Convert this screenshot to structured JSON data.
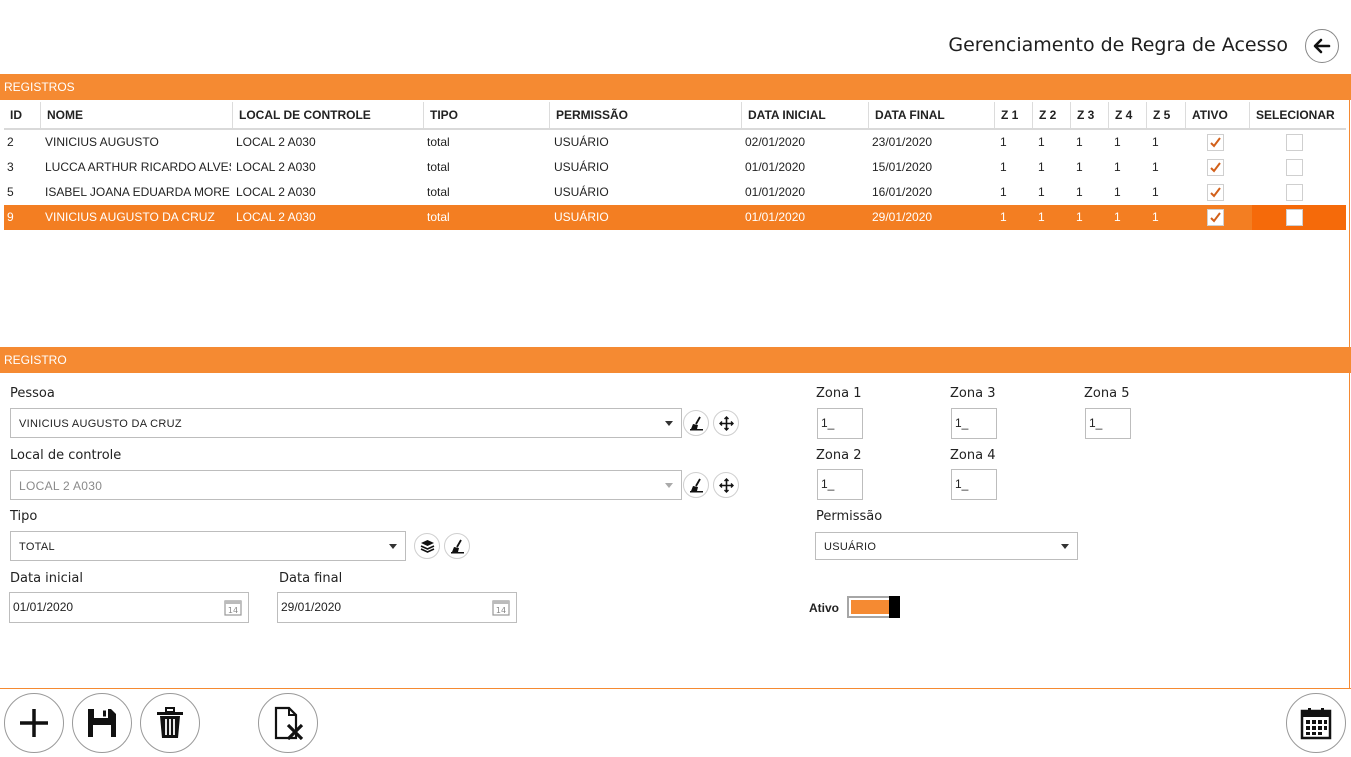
{
  "header": {
    "title": "Gerenciamento de Regra de Acesso",
    "back_icon": "arrow-left-icon"
  },
  "records_section": {
    "title": "REGISTROS"
  },
  "grid": {
    "columns": [
      "ID",
      "NOME",
      "LOCAL DE CONTROLE",
      "TIPO",
      "PERMISSÃO",
      "DATA INICIAL",
      "DATA FINAL",
      "Z 1",
      "Z 2",
      "Z 3",
      "Z 4",
      "Z 5",
      "ATIVO",
      "SELECIONAR"
    ],
    "rows": [
      {
        "id": "2",
        "nome": "VINICIUS AUGUSTO",
        "local": "LOCAL 2 A030",
        "tipo": "total",
        "permissao": "USUÁRIO",
        "data_inicial": "02/01/2020",
        "data_final": "23/01/2020",
        "z1": "1",
        "z2": "1",
        "z3": "1",
        "z4": "1",
        "z5": "1",
        "ativo": true,
        "selecionar": false,
        "selected": false
      },
      {
        "id": "3",
        "nome": "LUCCA ARTHUR RICARDO ALVES",
        "local": "LOCAL 2 A030",
        "tipo": "total",
        "permissao": "USUÁRIO",
        "data_inicial": "01/01/2020",
        "data_final": "15/01/2020",
        "z1": "1",
        "z2": "1",
        "z3": "1",
        "z4": "1",
        "z5": "1",
        "ativo": true,
        "selecionar": false,
        "selected": false
      },
      {
        "id": "5",
        "nome": "ISABEL JOANA EDUARDA MOREIRA",
        "local": "LOCAL 2 A030",
        "tipo": "total",
        "permissao": "USUÁRIO",
        "data_inicial": "01/01/2020",
        "data_final": "16/01/2020",
        "z1": "1",
        "z2": "1",
        "z3": "1",
        "z4": "1",
        "z5": "1",
        "ativo": true,
        "selecionar": false,
        "selected": false
      },
      {
        "id": "9",
        "nome": "VINICIUS AUGUSTO DA CRUZ",
        "local": "LOCAL 2 A030",
        "tipo": "total",
        "permissao": "USUÁRIO",
        "data_inicial": "01/01/2020",
        "data_final": "29/01/2020",
        "z1": "1",
        "z2": "1",
        "z3": "1",
        "z4": "1",
        "z5": "1",
        "ativo": true,
        "selecionar": false,
        "selected": true
      }
    ]
  },
  "record_section": {
    "title": "REGISTRO"
  },
  "form": {
    "pessoa": {
      "label": "Pessoa",
      "value": "VINICIUS AUGUSTO DA CRUZ"
    },
    "local": {
      "label": "Local de controle",
      "value": "LOCAL 2 A030"
    },
    "tipo": {
      "label": "Tipo",
      "value": "TOTAL"
    },
    "data_inicial": {
      "label": "Data inicial",
      "value": "01/01/2020"
    },
    "data_final": {
      "label": "Data final",
      "value": "29/01/2020"
    },
    "zona1": {
      "label": "Zona 1",
      "value": "1_"
    },
    "zona2": {
      "label": "Zona 2",
      "value": "1_"
    },
    "zona3": {
      "label": "Zona 3",
      "value": "1_"
    },
    "zona4": {
      "label": "Zona 4",
      "value": "1_"
    },
    "zona5": {
      "label": "Zona 5",
      "value": "1_"
    },
    "permissao": {
      "label": "Permissão",
      "value": "USUÁRIO"
    },
    "ativo": {
      "label": "Ativo",
      "on": true
    }
  },
  "toolbar": {
    "icons": [
      "plus-icon",
      "save-icon",
      "trash-icon",
      "clear-document-icon",
      "calendar-icon"
    ]
  },
  "colors": {
    "accent": "#f58a32",
    "selected_row": "#f37e22",
    "selected_cell": "#f56a0a"
  }
}
